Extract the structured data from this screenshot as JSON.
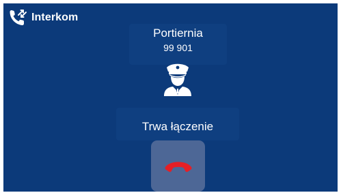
{
  "header": {
    "title": "Interkom",
    "icon": "phone-transfer-icon"
  },
  "contact": {
    "name": "Portiernia",
    "number": "99 901",
    "avatar_icon": "security-guard-icon"
  },
  "call": {
    "status": "Trwa łączenie",
    "hangup_icon": "hang-up-icon"
  },
  "colors": {
    "background": "#0c3a7a",
    "hangup_button": "#4d6796",
    "hangup_icon": "#e51f26",
    "text": "#ffffff"
  }
}
